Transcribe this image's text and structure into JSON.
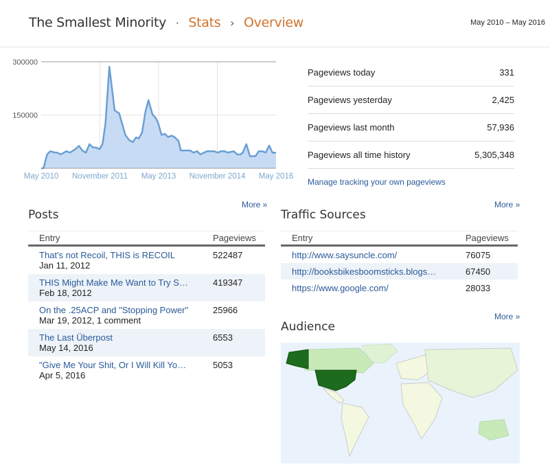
{
  "header": {
    "site": "The Smallest Minority",
    "sep": "·",
    "stats": "Stats",
    "arrow": "›",
    "page": "Overview",
    "range": "May 2010 – May 2016"
  },
  "chart_data": {
    "type": "area",
    "title": "",
    "xlabel": "",
    "ylabel": "",
    "ylim": [
      0,
      300000
    ],
    "yticks": [
      "300000",
      "150000"
    ],
    "ytick_values": [
      300000,
      150000
    ],
    "xticks": [
      "May 2010",
      "November 2011",
      "May 2013",
      "November 2014",
      "May 2016"
    ],
    "xtick_months": [
      0,
      18,
      36,
      54,
      72
    ],
    "x_month_index": [
      0,
      0.7,
      1.8,
      2.8,
      3.9,
      4.9,
      6,
      7.7,
      8.8,
      10.5,
      11.6,
      12.6,
      13.7,
      14.8,
      15.8,
      16.9,
      17.9,
      18.8,
      19.7,
      20.9,
      22.5,
      22.8,
      23.9,
      25.8,
      27,
      28.1,
      29.1,
      29.9,
      30.9,
      32,
      32.9,
      34.1,
      35.1,
      35.8,
      36.9,
      37.9,
      38.9,
      40,
      41,
      42.1,
      42.8,
      45.7,
      46.7,
      47.8,
      48.8,
      49.9,
      50.9,
      53,
      54.1,
      55.1,
      56.2,
      57.2,
      59,
      60.1,
      61.1,
      61.8,
      62.9,
      64,
      65.7,
      66.7,
      67.8,
      68.8,
      69.9,
      70.9,
      72
    ],
    "values": [
      0,
      0,
      39000,
      48000,
      45000,
      44000,
      39000,
      48000,
      44000,
      54000,
      63000,
      50000,
      44000,
      68000,
      59000,
      58000,
      54000,
      68000,
      126000,
      286000,
      164000,
      161000,
      155000,
      94000,
      79000,
      74000,
      87000,
      84000,
      100000,
      161000,
      192000,
      152000,
      142000,
      129000,
      94000,
      97000,
      88000,
      92000,
      87000,
      77000,
      50000,
      50000,
      44000,
      48000,
      39000,
      44000,
      48000,
      48000,
      44000,
      48000,
      48000,
      44000,
      48000,
      39000,
      39000,
      44000,
      68000,
      34000,
      34000,
      48000,
      48000,
      44000,
      64000,
      44000,
      44000
    ],
    "color": "#6a9fd4",
    "fill": "#c7dcf4"
  },
  "stats": [
    {
      "label": "Pageviews today",
      "value": "331"
    },
    {
      "label": "Pageviews yesterday",
      "value": "2,425"
    },
    {
      "label": "Pageviews last month",
      "value": "57,936"
    },
    {
      "label": "Pageviews all time history",
      "value": "5,305,348"
    }
  ],
  "manage": "Manage tracking your own pageviews",
  "more": "More »",
  "posts": {
    "title": "Posts",
    "col1": "Entry",
    "col2": "Pageviews",
    "rows": [
      {
        "title": "That's not Recoil, THIS is RECOIL",
        "meta": "Jan 11, 2012",
        "views": "522487"
      },
      {
        "title": "THIS Might Make Me Want to Try S…",
        "meta": "Feb 18, 2012",
        "views": "419347"
      },
      {
        "title": "On the .25ACP and \"Stopping Power\"",
        "meta": "Mar 19, 2012, 1 comment",
        "views": "25966"
      },
      {
        "title": "The Last Überpost",
        "meta": "May 14, 2016",
        "views": "6553"
      },
      {
        "title": "\"Give Me Your Shit, Or I Will Kill Yo…",
        "meta": "Apr 5, 2016",
        "views": "5053"
      }
    ]
  },
  "traffic": {
    "title": "Traffic Sources",
    "col1": "Entry",
    "col2": "Pageviews",
    "rows": [
      {
        "url": "http://www.saysuncle.com/",
        "views": "76075"
      },
      {
        "url": "http://booksbikesboomsticks.blogs…",
        "views": "67450"
      },
      {
        "url": "https://www.google.com/",
        "views": "28033"
      }
    ]
  },
  "audience": {
    "title": "Audience"
  }
}
